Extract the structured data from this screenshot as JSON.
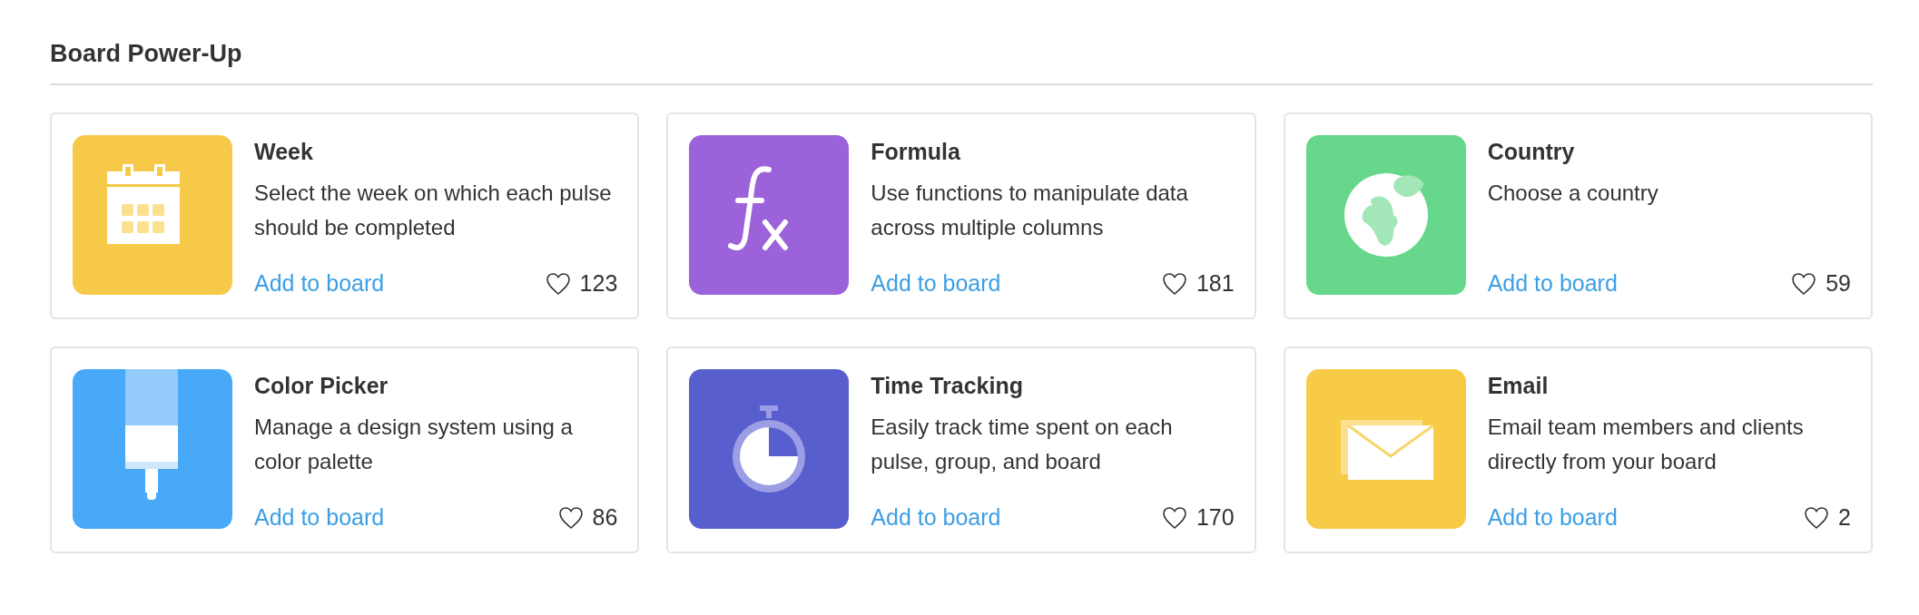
{
  "section": {
    "title": "Board Power-Up"
  },
  "cards": [
    {
      "kind": "calendar",
      "color": "#f7c948",
      "title": "Week",
      "description": "Select the week on which each pulse should be completed",
      "link": "Add to board",
      "likes": "123"
    },
    {
      "kind": "formula",
      "color": "#9b62d9",
      "title": "Formula",
      "description": "Use functions to manipulate data across multiple columns",
      "link": "Add to board",
      "likes": "181"
    },
    {
      "kind": "globe",
      "color": "#67d78b",
      "title": "Country",
      "description": "Choose a country",
      "link": "Add to board",
      "likes": "59"
    },
    {
      "kind": "brush",
      "color": "#48a9f8",
      "title": "Color Picker",
      "description": "Manage a design system using a color palette",
      "link": "Add to board",
      "likes": "86"
    },
    {
      "kind": "stopwatch",
      "color": "#585ecd",
      "title": "Time Tracking",
      "description": "Easily track time spent on each pulse, group, and board",
      "link": "Add to board",
      "likes": "170"
    },
    {
      "kind": "envelope",
      "color": "#f7cb48",
      "title": "Email",
      "description": "Email team members and clients directly from your board",
      "link": "Add to board",
      "likes": "2"
    }
  ]
}
